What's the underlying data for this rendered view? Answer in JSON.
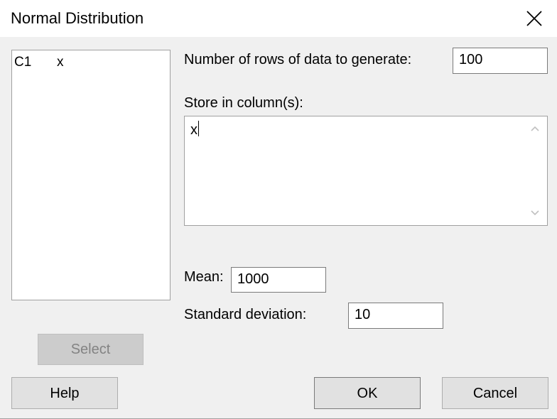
{
  "window": {
    "title": "Normal Distribution",
    "close_icon": "close-icon"
  },
  "variables_list": {
    "items": [
      {
        "column": "C1",
        "name": "x"
      }
    ]
  },
  "form": {
    "rows_label": "Number of rows of data to generate:",
    "rows_value": "100",
    "store_label": "Store in column(s):",
    "store_value": "x",
    "mean_label": "Mean:",
    "mean_value": "1000",
    "sd_label": "Standard deviation:",
    "sd_value": "10"
  },
  "buttons": {
    "select": "Select",
    "help": "Help",
    "ok": "OK",
    "cancel": "Cancel"
  }
}
